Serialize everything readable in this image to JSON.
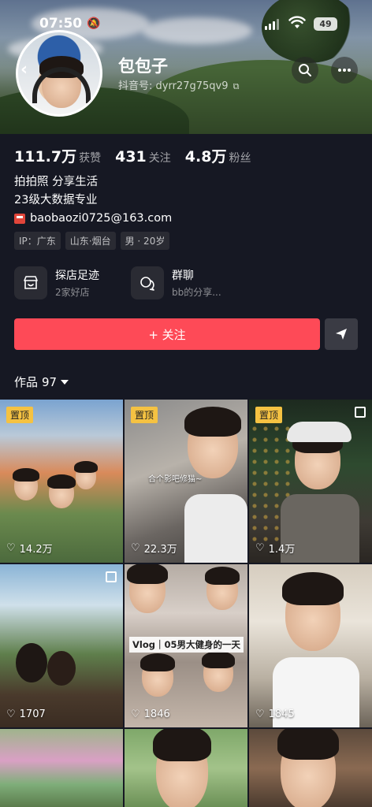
{
  "status_bar": {
    "time": "07:50",
    "battery": "49"
  },
  "profile": {
    "name": "包包子",
    "douyin_id": "抖音号: dyrr27g75qv9",
    "stats": [
      {
        "num": "111.7万",
        "label": "获赞"
      },
      {
        "num": "431",
        "label": "关注"
      },
      {
        "num": "4.8万",
        "label": "粉丝"
      }
    ],
    "bio": [
      "拍拍照 分享生活",
      "23级大数据专业"
    ],
    "email": "baobaozi0725@163.com",
    "tags": [
      "IP：广东",
      "山东·烟台",
      "男 · 20岁"
    ]
  },
  "features": [
    {
      "title": "探店足迹",
      "sub": "2家好店",
      "icon": "shop-icon"
    },
    {
      "title": "群聊",
      "sub": "bb的分享...",
      "icon": "chat-icon"
    }
  ],
  "actions": {
    "follow": "+ 关注"
  },
  "works": {
    "label": "作品",
    "count": "97"
  },
  "grid": [
    {
      "pinned": "置顶",
      "likes": "14.2万",
      "multi": false
    },
    {
      "pinned": "置顶",
      "likes": "22.3万",
      "multi": false,
      "overlay_text": "合个影吧修猫~"
    },
    {
      "pinned": "置顶",
      "likes": "1.4万",
      "multi": true
    },
    {
      "pinned": "",
      "likes": "1707",
      "multi": true
    },
    {
      "pinned": "",
      "likes": "1846",
      "multi": false,
      "caption": "Vlog｜05男大健身的一天"
    },
    {
      "pinned": "",
      "likes": "1845",
      "multi": false
    }
  ],
  "colors": {
    "accent": "#fe4a57",
    "pin": "#f5c242",
    "background": "#161823"
  }
}
